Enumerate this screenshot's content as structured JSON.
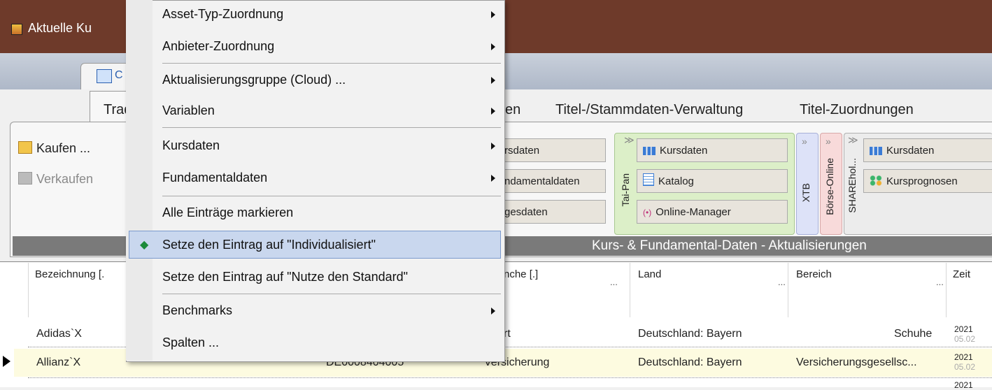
{
  "window": {
    "title": "Aktuelle Ku"
  },
  "colors": {
    "titlebar": "#6e3a2a",
    "menu_highlight": "#c9d7ee",
    "checkmark": "#1b8a3a",
    "selected_row": "#fdfbe0"
  },
  "ribbon": {
    "top_tab_label": "C",
    "tabs": [
      {
        "label": "Trad"
      },
      {
        "label": "en"
      },
      {
        "label": "Titel-/Stammdaten-Verwaltung"
      },
      {
        "label": "Titel-Zuordnungen"
      }
    ],
    "buttons": {
      "kaufen": "Kaufen ...",
      "verkaufen": "Verkaufen"
    },
    "group1": {
      "b1": "rsdaten",
      "b2": "ndamentaldaten",
      "b3": "gesdaten"
    },
    "taipan": {
      "label": "Tai-Pan",
      "b1": "Kursdaten",
      "b2": "Katalog",
      "b3": "Online-Manager"
    },
    "xtb": {
      "label": "XTB"
    },
    "boerse": {
      "label": "Börse-Online"
    },
    "sharehol": {
      "label": "SHAREhol...",
      "b1": "Kursdaten",
      "b2": "Kursprognosen"
    },
    "footer": "Kurs- & Fundamental-Daten - Aktualisierungen"
  },
  "grid": {
    "headers": {
      "bezeichnung": "Bezeichnung [.",
      "branche": "nche [.]",
      "land": "Land",
      "bereich": "Bereich",
      "zeit": "Zeit"
    },
    "dots": "...",
    "rows": [
      {
        "name": "Adidas`X",
        "isin": "",
        "branche": "rt",
        "land": "Deutschland: Bayern",
        "bereich": "Schuhe",
        "year": "2021",
        "date": "05.02"
      },
      {
        "name": "Allianz`X",
        "isin": "DE0008404005",
        "branche": "Versicherung",
        "land": "Deutschland: Bayern",
        "bereich": "Versicherungsgesellsc...",
        "year": "2021",
        "date": "05.02"
      }
    ],
    "partial_year": "2021"
  },
  "context_menu": {
    "items": [
      {
        "label": "Asset-Typ-Zuordnung",
        "submenu": true
      },
      {
        "label": "Anbieter-Zuordnung",
        "submenu": true
      },
      {
        "label": "Aktualisierungsgruppe (Cloud) ...",
        "submenu": true
      },
      {
        "label": "Variablen",
        "submenu": true
      },
      {
        "label": "Kursdaten",
        "submenu": true
      },
      {
        "label": "Fundamentaldaten",
        "submenu": true
      },
      {
        "label": "Alle Einträge markieren",
        "submenu": false
      },
      {
        "label": "Setze den Eintrag auf \"Individualisiert\"",
        "submenu": false,
        "checked": true,
        "highlighted": true
      },
      {
        "label": "Setze den Eintrag auf \"Nutze den Standard\"",
        "submenu": false
      },
      {
        "label": "Benchmarks",
        "submenu": true
      },
      {
        "label": "Spalten ...",
        "submenu": false
      }
    ],
    "check_glyph": "◆"
  }
}
